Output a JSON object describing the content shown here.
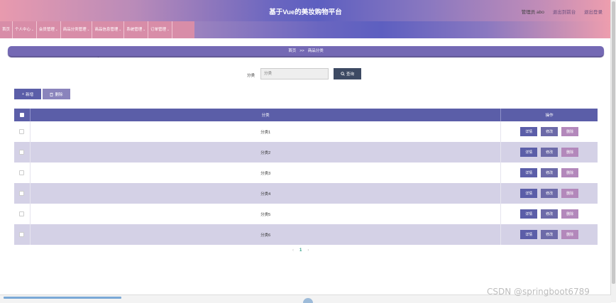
{
  "header": {
    "title": "基于Vue的美妆购物平台",
    "user": "管理员 abo",
    "back_label": "退出到前台",
    "logout_label": "退出登录"
  },
  "nav": {
    "items": [
      {
        "label": "首页",
        "chevron": false
      },
      {
        "label": "个人中心",
        "chevron": true
      },
      {
        "label": "会员管理",
        "chevron": true
      },
      {
        "label": "商品分类管理",
        "chevron": true
      },
      {
        "label": "商品信息管理",
        "chevron": true
      },
      {
        "label": "系统管理",
        "chevron": true
      },
      {
        "label": "订单管理",
        "chevron": true
      }
    ]
  },
  "breadcrumb": {
    "home": "首页",
    "separator": ">>",
    "current": "商品分类"
  },
  "search": {
    "label": "分类",
    "placeholder": "分类",
    "value": "",
    "button_label": "查询",
    "button_icon": "search-icon"
  },
  "toolbar": {
    "add_label": "新增",
    "add_icon": "plus-icon",
    "delete_label": "删除",
    "delete_icon": "trash-icon"
  },
  "table": {
    "columns": [
      "分类",
      "操作"
    ],
    "rows": [
      {
        "name": "分类1"
      },
      {
        "name": "分类2"
      },
      {
        "name": "分类3"
      },
      {
        "name": "分类4"
      },
      {
        "name": "分类5"
      },
      {
        "name": "分类6"
      }
    ],
    "actions": {
      "detail": "详情",
      "edit": "修改",
      "delete": "删除"
    }
  },
  "pagination": {
    "prev": "‹",
    "current": "1",
    "next": "›"
  },
  "watermark": "CSDN @springboot6789",
  "colors": {
    "primary": "#5b5ea8",
    "accent_pink": "#d88da8",
    "breadcrumb": "#7469b4",
    "row_alt": "#d4d1e6",
    "search_button": "#3d4a63",
    "delete_button": "#b388bb"
  }
}
